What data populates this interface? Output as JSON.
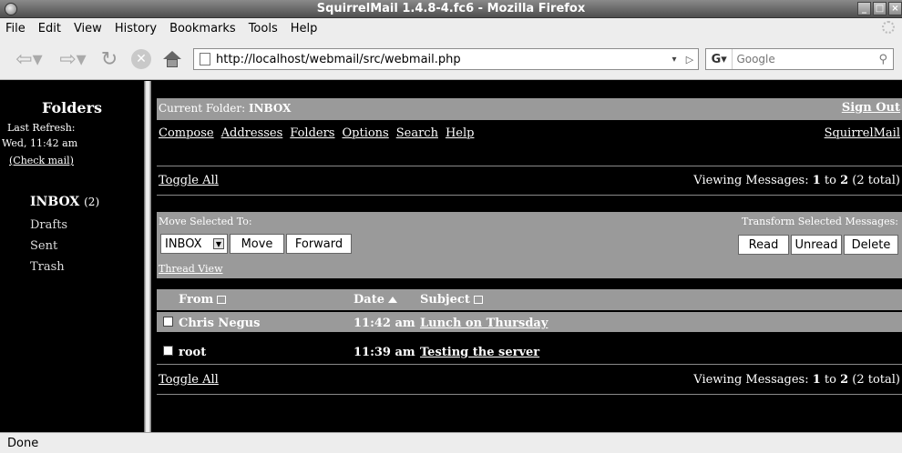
{
  "window": {
    "title": "SquirrelMail 1.4.8-4.fc6 - Mozilla Firefox",
    "buttons": [
      "_",
      "□",
      "×"
    ]
  },
  "menu": [
    "File",
    "Edit",
    "View",
    "History",
    "Bookmarks",
    "Tools",
    "Help"
  ],
  "nav": {
    "url": "http://localhost/webmail/src/webmail.php",
    "search_placeholder": "Google",
    "search_engine": "G"
  },
  "folders": {
    "title": "Folders",
    "last_refresh_label": "Last Refresh:",
    "last_refresh_time": "Wed, 11:42 am",
    "check_mail": "(Check mail)",
    "inbox_label": "INBOX",
    "inbox_count": "(2)",
    "items": [
      "Drafts",
      "Sent",
      "Trash"
    ]
  },
  "main": {
    "current_folder_label": "Current Folder: ",
    "current_folder": "INBOX",
    "sign_out": "Sign Out",
    "links": [
      "Compose",
      "Addresses",
      "Folders",
      "Options",
      "Search",
      "Help"
    ],
    "brand": "SquirrelMail",
    "toggle_all": "Toggle All",
    "viewing_prefix": "Viewing Messages: ",
    "viewing_from": "1",
    "viewing_to_word": " to ",
    "viewing_to": "2",
    "viewing_total": " (2 total)",
    "move_selected_label": "Move Selected To:",
    "transform_label": "Transform Selected Messages:",
    "move_target": "INBOX",
    "move_button": "Move",
    "forward_button": "Forward",
    "read_button": "Read",
    "unread_button": "Unread",
    "delete_button": "Delete",
    "thread_view": "Thread View",
    "columns": {
      "from": "From",
      "date": "Date",
      "subject": "Subject"
    },
    "messages": [
      {
        "from": "Chris Negus",
        "date": "11:42 am",
        "subject": "Lunch on Thursday"
      },
      {
        "from": "root",
        "date": "11:39 am",
        "subject": "Testing the server"
      }
    ]
  },
  "status": "Done"
}
